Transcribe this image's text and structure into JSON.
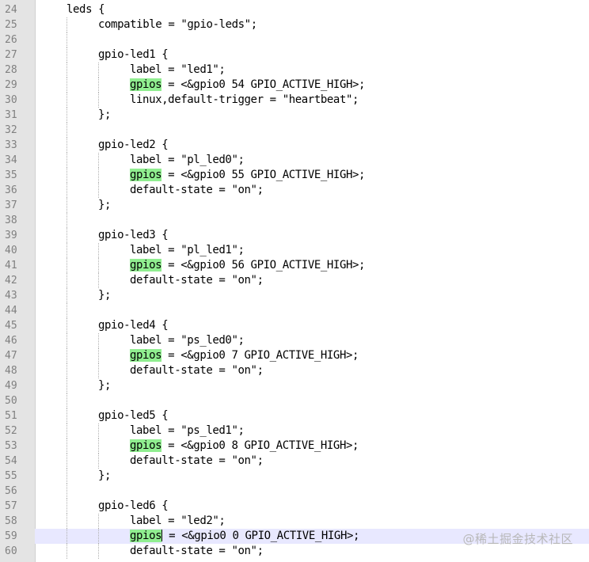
{
  "editor": {
    "current_line": 59,
    "highlight_color": "#90ee90",
    "current_line_color": "#e8e8ff",
    "lines": [
      {
        "num": "24",
        "indent": 0,
        "segments": [
          {
            "t": "leds {"
          }
        ]
      },
      {
        "num": "25",
        "indent": 1,
        "segments": [
          {
            "t": "compatible = \"gpio-leds\";"
          }
        ]
      },
      {
        "num": "26",
        "indent": 1,
        "segments": []
      },
      {
        "num": "27",
        "indent": 1,
        "segments": [
          {
            "t": "gpio-led1 {"
          }
        ]
      },
      {
        "num": "28",
        "indent": 2,
        "segments": [
          {
            "t": "label = \"led1\";"
          }
        ]
      },
      {
        "num": "29",
        "indent": 2,
        "segments": [
          {
            "t": "gpios",
            "hl": true
          },
          {
            "t": " = <&gpio0 54 GPIO_ACTIVE_HIGH>;"
          }
        ]
      },
      {
        "num": "30",
        "indent": 2,
        "segments": [
          {
            "t": "linux,default-trigger = \"heartbeat\";"
          }
        ]
      },
      {
        "num": "31",
        "indent": 1,
        "segments": [
          {
            "t": "};"
          }
        ]
      },
      {
        "num": "32",
        "indent": 1,
        "segments": []
      },
      {
        "num": "33",
        "indent": 1,
        "segments": [
          {
            "t": "gpio-led2 {"
          }
        ]
      },
      {
        "num": "34",
        "indent": 2,
        "segments": [
          {
            "t": "label = \"pl_led0\";"
          }
        ]
      },
      {
        "num": "35",
        "indent": 2,
        "segments": [
          {
            "t": "gpios",
            "hl": true
          },
          {
            "t": " = <&gpio0 55 GPIO_ACTIVE_HIGH>;"
          }
        ]
      },
      {
        "num": "36",
        "indent": 2,
        "segments": [
          {
            "t": "default-state = \"on\";"
          }
        ]
      },
      {
        "num": "37",
        "indent": 1,
        "segments": [
          {
            "t": "};"
          }
        ]
      },
      {
        "num": "38",
        "indent": 1,
        "segments": []
      },
      {
        "num": "39",
        "indent": 1,
        "segments": [
          {
            "t": "gpio-led3 {"
          }
        ]
      },
      {
        "num": "40",
        "indent": 2,
        "segments": [
          {
            "t": "label = \"pl_led1\";"
          }
        ]
      },
      {
        "num": "41",
        "indent": 2,
        "segments": [
          {
            "t": "gpios",
            "hl": true
          },
          {
            "t": " = <&gpio0 56 GPIO_ACTIVE_HIGH>;"
          }
        ]
      },
      {
        "num": "42",
        "indent": 2,
        "segments": [
          {
            "t": "default-state = \"on\";"
          }
        ]
      },
      {
        "num": "43",
        "indent": 1,
        "segments": [
          {
            "t": "};"
          }
        ]
      },
      {
        "num": "44",
        "indent": 1,
        "segments": []
      },
      {
        "num": "45",
        "indent": 1,
        "segments": [
          {
            "t": "gpio-led4 {"
          }
        ]
      },
      {
        "num": "46",
        "indent": 2,
        "segments": [
          {
            "t": "label = \"ps_led0\";"
          }
        ]
      },
      {
        "num": "47",
        "indent": 2,
        "segments": [
          {
            "t": "gpios",
            "hl": true
          },
          {
            "t": " = <&gpio0 7 GPIO_ACTIVE_HIGH>;"
          }
        ]
      },
      {
        "num": "48",
        "indent": 2,
        "segments": [
          {
            "t": "default-state = \"on\";"
          }
        ]
      },
      {
        "num": "49",
        "indent": 1,
        "segments": [
          {
            "t": "};"
          }
        ]
      },
      {
        "num": "50",
        "indent": 1,
        "segments": []
      },
      {
        "num": "51",
        "indent": 1,
        "segments": [
          {
            "t": "gpio-led5 {"
          }
        ]
      },
      {
        "num": "52",
        "indent": 2,
        "segments": [
          {
            "t": "label = \"ps_led1\";"
          }
        ]
      },
      {
        "num": "53",
        "indent": 2,
        "segments": [
          {
            "t": "gpios",
            "hl": true
          },
          {
            "t": " = <&gpio0 8 GPIO_ACTIVE_HIGH>;"
          }
        ]
      },
      {
        "num": "54",
        "indent": 2,
        "segments": [
          {
            "t": "default-state = \"on\";"
          }
        ]
      },
      {
        "num": "55",
        "indent": 1,
        "segments": [
          {
            "t": "};"
          }
        ]
      },
      {
        "num": "56",
        "indent": 1,
        "segments": []
      },
      {
        "num": "57",
        "indent": 1,
        "segments": [
          {
            "t": "gpio-led6 {"
          }
        ]
      },
      {
        "num": "58",
        "indent": 2,
        "segments": [
          {
            "t": "label = \"led2\";"
          }
        ]
      },
      {
        "num": "59",
        "indent": 2,
        "segments": [
          {
            "t": "gpios",
            "hl": true,
            "caret": true
          },
          {
            "t": " = <&gpio0 0 GPIO_ACTIVE_HIGH>;"
          }
        ]
      },
      {
        "num": "60",
        "indent": 2,
        "segments": [
          {
            "t": "default-state = \"on\";"
          }
        ]
      }
    ]
  },
  "watermark": "@稀土掘金技术社区"
}
